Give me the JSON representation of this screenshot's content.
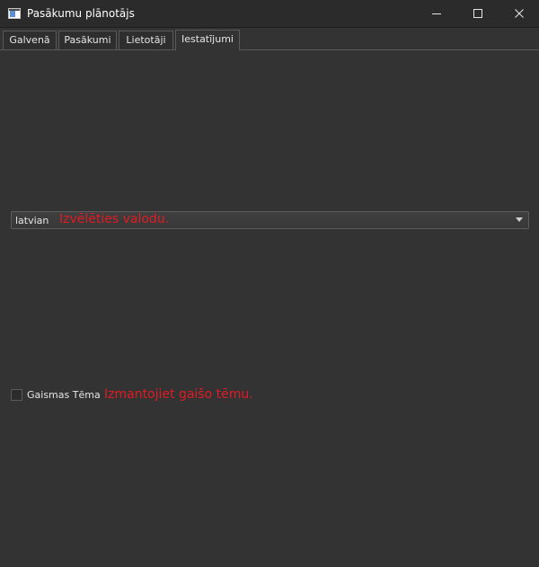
{
  "window": {
    "title": "Pasākumu plānotājs"
  },
  "tabs": [
    {
      "label": "Galvenā",
      "active": false
    },
    {
      "label": "Pasākumi",
      "active": false
    },
    {
      "label": "Lietotāji",
      "active": false
    },
    {
      "label": "Iestatījumi",
      "active": true
    }
  ],
  "settings": {
    "language": {
      "selected": "latvian",
      "hint": "Izvēlēties valodu."
    },
    "light_theme": {
      "label": "Gaismas Tēma",
      "checked": false,
      "hint": "Izmantojiet gaišo tēmu."
    }
  },
  "colors": {
    "background": "#333333",
    "titlebar": "#2b2b2b",
    "hint_text": "#e01b24",
    "text": "#e6e6e6"
  },
  "icons": {
    "app": "app-window-icon",
    "minimize": "minimize-icon",
    "maximize": "maximize-icon",
    "close": "close-icon",
    "dropdown": "chevron-down-icon"
  }
}
